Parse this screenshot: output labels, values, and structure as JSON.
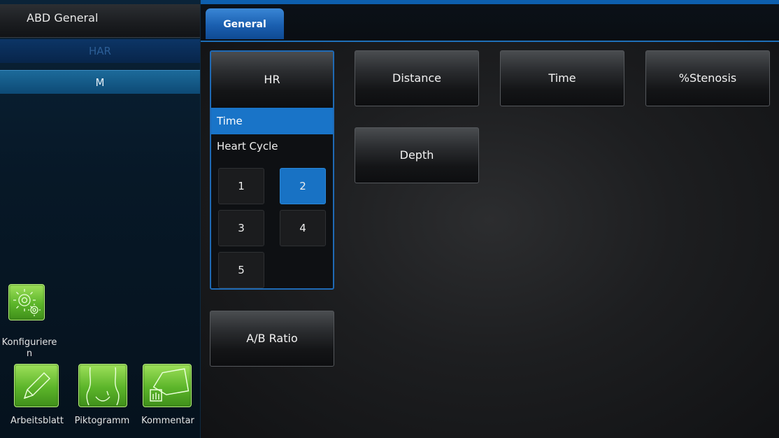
{
  "preset": {
    "title": "ABD General"
  },
  "modes": [
    {
      "label": "HAR"
    },
    {
      "label": "M"
    }
  ],
  "apps": {
    "configure": "Konfiguriere\nn",
    "worksheet": "Arbeitsblatt",
    "pictogram": "Piktogramm",
    "comment": "Kommentar"
  },
  "tabs": [
    {
      "label": "General"
    }
  ],
  "measurements": {
    "hr": {
      "label": "HR",
      "options": [
        "Time",
        "Heart Cycle"
      ],
      "selected_option": "Time",
      "cycles": [
        "1",
        "2",
        "3",
        "4",
        "5"
      ],
      "selected_cycle": "2"
    },
    "distance": "Distance",
    "time": "Time",
    "stenosis": "%Stenosis",
    "depth": "Depth",
    "ab_ratio": "A/B Ratio"
  },
  "colors": {
    "accent": "#1974c8",
    "tile_green": "#5cb52a"
  },
  "icons": [
    "gears-icon",
    "pencil-icon",
    "body-pictogram-icon",
    "label-comment-icon"
  ]
}
